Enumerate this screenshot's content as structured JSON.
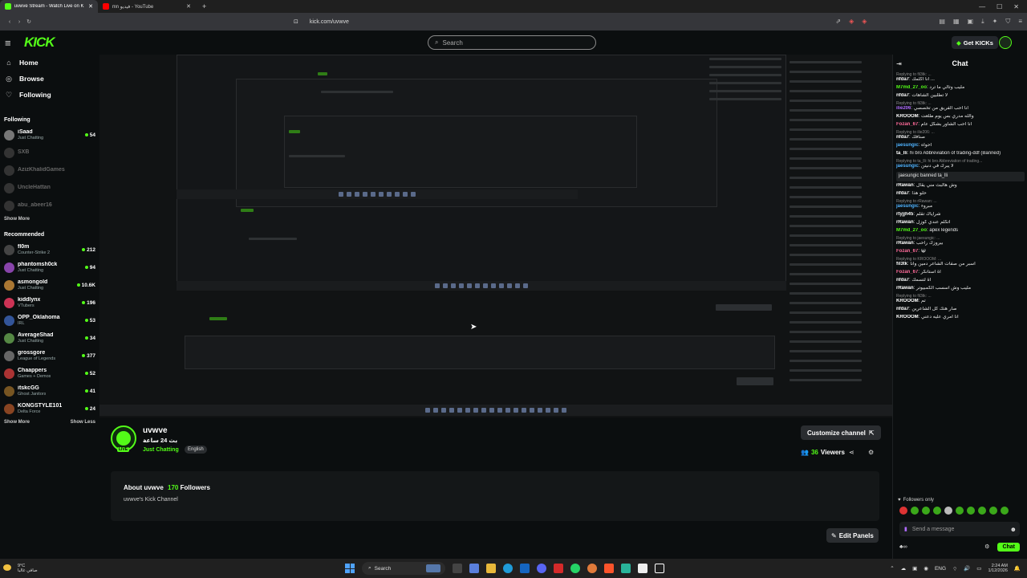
{
  "browser": {
    "tabs": [
      {
        "title": "uvwve Stream - Watch Live on K",
        "active": true,
        "color": "#53fc18"
      },
      {
        "title": "mn فيديو - YouTube",
        "active": false,
        "color": "#ff0000"
      }
    ],
    "url": "kick.com/uvwve"
  },
  "header": {
    "logo": "KICK",
    "search_placeholder": "Search",
    "get_kicks": "Get KICKs"
  },
  "sidebar": {
    "nav": [
      {
        "label": "Home",
        "icon": "home-icon"
      },
      {
        "label": "Browse",
        "icon": "compass-icon"
      },
      {
        "label": "Following",
        "icon": "heart-icon"
      }
    ],
    "following_title": "Following",
    "following": [
      {
        "name": "iSaad",
        "category": "Just Chatting",
        "viewers": "54",
        "color": "#777",
        "online": true
      },
      {
        "name": "SXB",
        "category": "",
        "viewers": "",
        "online": false
      },
      {
        "name": "AzizKhalidGames",
        "category": "",
        "viewers": "",
        "online": false
      },
      {
        "name": "UncleHattan",
        "category": "",
        "viewers": "",
        "online": false
      },
      {
        "name": "abu_abeer16",
        "category": "",
        "viewers": "",
        "online": false
      }
    ],
    "show_more_1": "Show More",
    "recommended_title": "Recommended",
    "recommended": [
      {
        "name": "fl0m",
        "category": "Counter-Strike 2",
        "viewers": "212",
        "color": "#444"
      },
      {
        "name": "phantomsh0ck",
        "category": "Just Chatting",
        "viewers": "94",
        "color": "#8844aa"
      },
      {
        "name": "asmongold",
        "category": "Just Chatting",
        "viewers": "10.6K",
        "color": "#aa7733"
      },
      {
        "name": "kiddlynx",
        "category": "VTubers",
        "viewers": "196",
        "color": "#cc3355"
      },
      {
        "name": "OPP_Oklahoma",
        "category": "IRL",
        "viewers": "53",
        "color": "#335599"
      },
      {
        "name": "AverageShad",
        "category": "Just Chatting",
        "viewers": "34",
        "color": "#558844"
      },
      {
        "name": "grossgore",
        "category": "League of Legends",
        "viewers": "377",
        "color": "#666"
      },
      {
        "name": "Chaappers",
        "category": "Games + Demos",
        "viewers": "52",
        "color": "#aa3333"
      },
      {
        "name": "itskcGG",
        "category": "Ghost Janitors",
        "viewers": "41",
        "color": "#775522"
      },
      {
        "name": "KONGSTYLE101",
        "category": "Delta Force",
        "viewers": "24",
        "color": "#884422"
      }
    ],
    "show_more_2": "Show More",
    "show_less": "Show Less"
  },
  "stream": {
    "name": "uvwve",
    "title": "بث 24 ساعة",
    "category": "Just Chatting",
    "language": "English",
    "customize_label": "Customize channel",
    "viewers": "36",
    "viewers_label": "Viewers",
    "about_title": "About uvwve",
    "followers": "170",
    "followers_label": "Followers",
    "about_desc": "uvwve's Kick Channel",
    "edit_panels": "Edit Panels"
  },
  "chat": {
    "title": "Chat",
    "messages": [
      {
        "reply": "Replying to fil3tk: ...",
        "user": "nfda7",
        "color": "#ffffff",
        "text": "انا اكلمك ..."
      },
      {
        "reply": "",
        "user": "M7md_27_oo",
        "color": "#53fc18",
        "text": "مليب وتالي ما ترد"
      },
      {
        "reply": "",
        "user": "nfda7",
        "color": "#ffffff",
        "text": "لا تطلبين الشاهات"
      },
      {
        "reply": "Replying to fil3tk: ...",
        "user": "ilie206",
        "color": "#b06bff",
        "text": "انا احب الفريق من تخصصي"
      },
      {
        "reply": "",
        "user": "KROOOM",
        "color": "#ffffff",
        "text": "والله مدري بس يوم طلعت"
      },
      {
        "reply": "",
        "user": "Fozan_67",
        "color": "#ff6b9a",
        "text": "انا احب الشاور بشكل عام"
      },
      {
        "reply": "Replying to ilie206: ...",
        "user": "nfda7",
        "color": "#ffffff",
        "text": "صنافك"
      },
      {
        "reply": "",
        "user": "jaesungic",
        "color": "#4fb3ff",
        "text": "احواه"
      },
      {
        "reply": "",
        "user": "ta_lli",
        "color": "#ffffff",
        "text": "hi bro Abbreviation of trading-ddf (Banned)"
      },
      {
        "reply": "Replying to ta_lli: hi bro Abbreviation of trading...",
        "user": "jaesungic",
        "color": "#4fb3ff",
        "text": "لا يبرك في دنيتن"
      },
      {
        "banned": true,
        "text": "jaesungic banned ta_lli"
      },
      {
        "reply": "",
        "user": "rRawan",
        "color": "#ffffff",
        "text": "وش هالبث مني يقال"
      },
      {
        "reply": "",
        "user": "nfda7",
        "color": "#ffffff",
        "text": "حلو هذا"
      },
      {
        "reply": "Replying to rRawan: ...",
        "user": "jaesungic",
        "color": "#4fb3ff",
        "text": "مبروء"
      },
      {
        "reply": "",
        "user": "rtyjjh45",
        "color": "#ffffff",
        "text": "شراياك تقلم"
      },
      {
        "reply": "",
        "user": "rRawan",
        "color": "#ffffff",
        "text": "اتكلم عندي كوزل"
      },
      {
        "reply": "",
        "user": "M7md_27_oo",
        "color": "#53fc18",
        "text": "apex legends"
      },
      {
        "reply": "Replying to jaesungic: ...",
        "user": "rRawan",
        "color": "#ffffff",
        "text": "بيروزك راحب"
      },
      {
        "reply": "",
        "user": "Fozan_67",
        "color": "#ff6b9a",
        "text": "😀"
      },
      {
        "reply": "Replying to KROOOM: ...",
        "user": "fil3tk",
        "color": "#ffffff",
        "text": "أسبر من صفات الشاعر دمين وأنا"
      },
      {
        "reply": "",
        "user": "Fozan_67",
        "color": "#ff6b9a",
        "text": "اة استانكر"
      },
      {
        "reply": "",
        "user": "nfda7",
        "color": "#ffffff",
        "text": "اة لتسمك"
      },
      {
        "reply": "",
        "user": "rRawan",
        "color": "#ffffff",
        "text": "مليب وش اسسب الكمبيوتر"
      },
      {
        "reply": "Replying to fil3tk: ...",
        "user": "KROOOM",
        "color": "#ffffff",
        "text": "تم"
      },
      {
        "reply": "",
        "user": "nfda7",
        "color": "#ffffff",
        "text": "صار هنك كل الشاعرين"
      },
      {
        "reply": "",
        "user": "KROOOM",
        "color": "#ffffff",
        "text": "انا امري عليه دعني"
      }
    ],
    "followers_only": "Followers only",
    "send_placeholder": "Send a message",
    "chat_button": "Chat"
  },
  "taskbar": {
    "temp": "9°C",
    "weather": "صافي غالبا",
    "search": "Search",
    "lang": "ENG",
    "time": "2:24 AM",
    "date": "1/12/2026"
  }
}
